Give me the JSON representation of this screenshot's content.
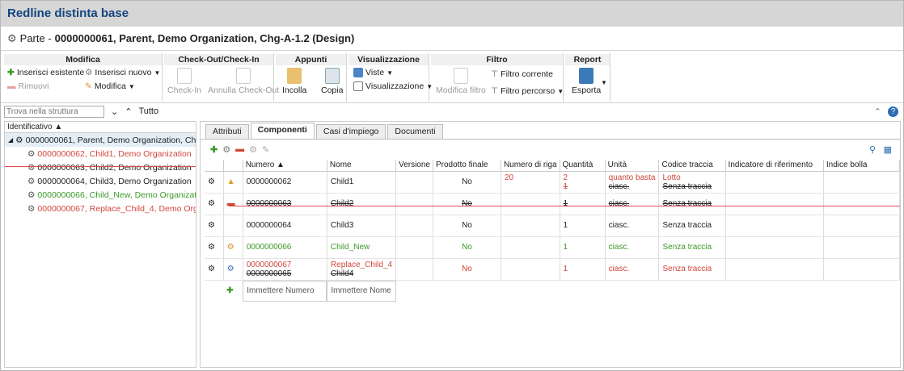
{
  "app": {
    "title": "Redline distinta base"
  },
  "part": {
    "prefix": "Parte -",
    "title": "0000000061, Parent, Demo Organization, Chg-A-1.2 (Design)"
  },
  "ribbon": {
    "modifica": {
      "title": "Modifica",
      "insert_existing": "Inserisci esistente",
      "insert_new": "Inserisci nuovo",
      "remove": "Rimuovi",
      "modify": "Modifica"
    },
    "checkout": {
      "title": "Check-Out/Check-In",
      "checkin": "Check-In",
      "cancel_checkout": "Annulla Check-Out"
    },
    "appunti": {
      "title": "Appunti",
      "paste": "Incolla",
      "copy": "Copia"
    },
    "view": {
      "title": "Visualizzazione",
      "views": "Viste",
      "display": "Visualizzazione"
    },
    "filter": {
      "title": "Filtro",
      "modify_filter": "Modifica filtro",
      "current_filter": "Filtro corrente",
      "path_filter": "Filtro percorso"
    },
    "report": {
      "title": "Report",
      "export": "Esporta"
    }
  },
  "search": {
    "placeholder": "Trova nella struttura",
    "all_label": "Tutto"
  },
  "tree": {
    "header": "Identificativo",
    "root": "0000000061, Parent, Demo Organization, Chg-A-1.2",
    "children": [
      {
        "label": "0000000062, Child1, Demo Organization",
        "state": "red"
      },
      {
        "label": "0000000063, Child2, Demo Organization",
        "state": "struck"
      },
      {
        "label": "0000000064, Child3, Demo Organization",
        "state": "normal"
      },
      {
        "label": "0000000066, Child_New, Demo Organization",
        "state": "green"
      },
      {
        "label": "0000000067, Replace_Child_4, Demo Organization",
        "state": "red"
      }
    ]
  },
  "tabs": [
    "Attributi",
    "Componenti",
    "Casi d'impiego",
    "Documenti"
  ],
  "table": {
    "columns": [
      "Numero",
      "Nome",
      "Versione",
      "Prodotto finale",
      "Numero di riga",
      "Quantità",
      "Unità",
      "Codice traccia",
      "Indicatore di riferimento",
      "Indice bolla"
    ],
    "rows": [
      {
        "numero": "0000000062",
        "nome": "Child1",
        "prodotto": "No",
        "riga": "20",
        "qty_new": "2",
        "qty_old": "1",
        "unit_new": "quanto basta",
        "unit_old": "ciasc.",
        "trace_new": "Lotto",
        "trace_old": "Senza traccia"
      },
      {
        "numero": "0000000063",
        "nome": "Child2",
        "prodotto": "No",
        "qty": "1",
        "unit": "ciasc.",
        "trace": "Senza traccia"
      },
      {
        "numero": "0000000064",
        "nome": "Child3",
        "prodotto": "No",
        "qty": "1",
        "unit": "ciasc.",
        "trace": "Senza traccia"
      },
      {
        "numero": "0000000066",
        "nome": "Child_New",
        "prodotto": "No",
        "qty": "1",
        "unit": "ciasc.",
        "trace": "Senza traccia"
      },
      {
        "numero_new": "0000000067",
        "numero_old": "0000000065",
        "nome_new": "Replace_Child_4",
        "nome_old": "Child4",
        "prodotto": "No",
        "qty": "1",
        "unit": "ciasc.",
        "trace": "Senza traccia"
      }
    ],
    "new_row": {
      "numero_placeholder": "Immettere Numero",
      "nome_placeholder": "Immettere Nome"
    }
  },
  "colors": {
    "title": "#12467f",
    "changed": "#d0463b",
    "added": "#3c9a28"
  }
}
